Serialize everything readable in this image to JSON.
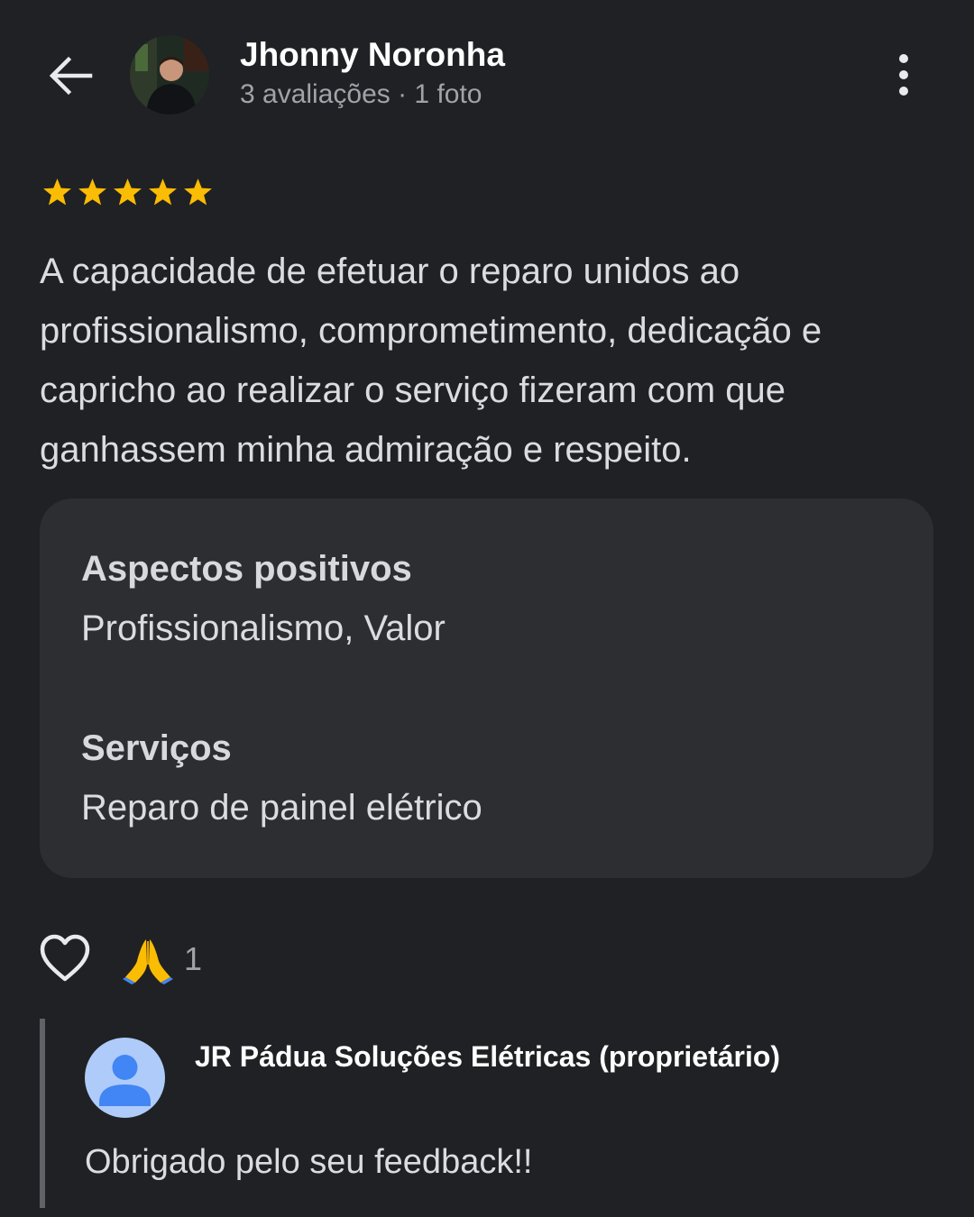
{
  "header": {
    "back_icon": "arrow-left-icon",
    "user_name": "Jhonny Noronha",
    "user_meta": "3 avaliações · 1 foto",
    "more_icon": "more-vertical-icon"
  },
  "review": {
    "rating": 5,
    "rating_max": 5,
    "star_color": "#fbbc04",
    "text": "A capacidade de efetuar o reparo unidos ao profissionalismo, comprometimento, dedicação e capricho ao realizar o serviço fizeram com que ganhassem minha admiração e respeito."
  },
  "details": {
    "positives_title": "Aspectos positivos",
    "positives_value": "Profissionalismo, Valor",
    "services_title": "Serviços",
    "services_value": "Reparo de painel elétrico"
  },
  "actions": {
    "like_icon": "heart-outline-icon",
    "reaction_icon": "folded-hands-icon",
    "reaction_count": "1"
  },
  "owner_reply": {
    "name": "JR Pádua Soluções Elétricas (proprietário)",
    "text": "Obrigado pelo seu feedback!!",
    "avatar_color": "#aecbfa",
    "avatar_figure_color": "#4285f4"
  }
}
